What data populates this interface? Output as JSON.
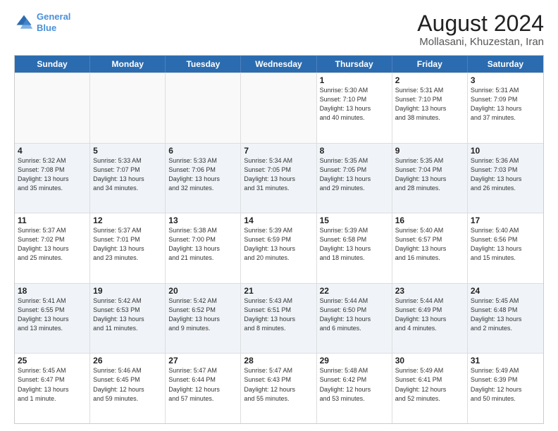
{
  "header": {
    "logo_line1": "General",
    "logo_line2": "Blue",
    "main_title": "August 2024",
    "sub_title": "Mollasani, Khuzestan, Iran"
  },
  "days_of_week": [
    "Sunday",
    "Monday",
    "Tuesday",
    "Wednesday",
    "Thursday",
    "Friday",
    "Saturday"
  ],
  "rows": [
    [
      {
        "day": "",
        "info": "",
        "empty": true
      },
      {
        "day": "",
        "info": "",
        "empty": true
      },
      {
        "day": "",
        "info": "",
        "empty": true
      },
      {
        "day": "",
        "info": "",
        "empty": true
      },
      {
        "day": "1",
        "info": "Sunrise: 5:30 AM\nSunset: 7:10 PM\nDaylight: 13 hours\nand 40 minutes.",
        "empty": false
      },
      {
        "day": "2",
        "info": "Sunrise: 5:31 AM\nSunset: 7:10 PM\nDaylight: 13 hours\nand 38 minutes.",
        "empty": false
      },
      {
        "day": "3",
        "info": "Sunrise: 5:31 AM\nSunset: 7:09 PM\nDaylight: 13 hours\nand 37 minutes.",
        "empty": false
      }
    ],
    [
      {
        "day": "4",
        "info": "Sunrise: 5:32 AM\nSunset: 7:08 PM\nDaylight: 13 hours\nand 35 minutes.",
        "empty": false
      },
      {
        "day": "5",
        "info": "Sunrise: 5:33 AM\nSunset: 7:07 PM\nDaylight: 13 hours\nand 34 minutes.",
        "empty": false
      },
      {
        "day": "6",
        "info": "Sunrise: 5:33 AM\nSunset: 7:06 PM\nDaylight: 13 hours\nand 32 minutes.",
        "empty": false
      },
      {
        "day": "7",
        "info": "Sunrise: 5:34 AM\nSunset: 7:05 PM\nDaylight: 13 hours\nand 31 minutes.",
        "empty": false
      },
      {
        "day": "8",
        "info": "Sunrise: 5:35 AM\nSunset: 7:05 PM\nDaylight: 13 hours\nand 29 minutes.",
        "empty": false
      },
      {
        "day": "9",
        "info": "Sunrise: 5:35 AM\nSunset: 7:04 PM\nDaylight: 13 hours\nand 28 minutes.",
        "empty": false
      },
      {
        "day": "10",
        "info": "Sunrise: 5:36 AM\nSunset: 7:03 PM\nDaylight: 13 hours\nand 26 minutes.",
        "empty": false
      }
    ],
    [
      {
        "day": "11",
        "info": "Sunrise: 5:37 AM\nSunset: 7:02 PM\nDaylight: 13 hours\nand 25 minutes.",
        "empty": false
      },
      {
        "day": "12",
        "info": "Sunrise: 5:37 AM\nSunset: 7:01 PM\nDaylight: 13 hours\nand 23 minutes.",
        "empty": false
      },
      {
        "day": "13",
        "info": "Sunrise: 5:38 AM\nSunset: 7:00 PM\nDaylight: 13 hours\nand 21 minutes.",
        "empty": false
      },
      {
        "day": "14",
        "info": "Sunrise: 5:39 AM\nSunset: 6:59 PM\nDaylight: 13 hours\nand 20 minutes.",
        "empty": false
      },
      {
        "day": "15",
        "info": "Sunrise: 5:39 AM\nSunset: 6:58 PM\nDaylight: 13 hours\nand 18 minutes.",
        "empty": false
      },
      {
        "day": "16",
        "info": "Sunrise: 5:40 AM\nSunset: 6:57 PM\nDaylight: 13 hours\nand 16 minutes.",
        "empty": false
      },
      {
        "day": "17",
        "info": "Sunrise: 5:40 AM\nSunset: 6:56 PM\nDaylight: 13 hours\nand 15 minutes.",
        "empty": false
      }
    ],
    [
      {
        "day": "18",
        "info": "Sunrise: 5:41 AM\nSunset: 6:55 PM\nDaylight: 13 hours\nand 13 minutes.",
        "empty": false
      },
      {
        "day": "19",
        "info": "Sunrise: 5:42 AM\nSunset: 6:53 PM\nDaylight: 13 hours\nand 11 minutes.",
        "empty": false
      },
      {
        "day": "20",
        "info": "Sunrise: 5:42 AM\nSunset: 6:52 PM\nDaylight: 13 hours\nand 9 minutes.",
        "empty": false
      },
      {
        "day": "21",
        "info": "Sunrise: 5:43 AM\nSunset: 6:51 PM\nDaylight: 13 hours\nand 8 minutes.",
        "empty": false
      },
      {
        "day": "22",
        "info": "Sunrise: 5:44 AM\nSunset: 6:50 PM\nDaylight: 13 hours\nand 6 minutes.",
        "empty": false
      },
      {
        "day": "23",
        "info": "Sunrise: 5:44 AM\nSunset: 6:49 PM\nDaylight: 13 hours\nand 4 minutes.",
        "empty": false
      },
      {
        "day": "24",
        "info": "Sunrise: 5:45 AM\nSunset: 6:48 PM\nDaylight: 13 hours\nand 2 minutes.",
        "empty": false
      }
    ],
    [
      {
        "day": "25",
        "info": "Sunrise: 5:45 AM\nSunset: 6:47 PM\nDaylight: 13 hours\nand 1 minute.",
        "empty": false
      },
      {
        "day": "26",
        "info": "Sunrise: 5:46 AM\nSunset: 6:45 PM\nDaylight: 12 hours\nand 59 minutes.",
        "empty": false
      },
      {
        "day": "27",
        "info": "Sunrise: 5:47 AM\nSunset: 6:44 PM\nDaylight: 12 hours\nand 57 minutes.",
        "empty": false
      },
      {
        "day": "28",
        "info": "Sunrise: 5:47 AM\nSunset: 6:43 PM\nDaylight: 12 hours\nand 55 minutes.",
        "empty": false
      },
      {
        "day": "29",
        "info": "Sunrise: 5:48 AM\nSunset: 6:42 PM\nDaylight: 12 hours\nand 53 minutes.",
        "empty": false
      },
      {
        "day": "30",
        "info": "Sunrise: 5:49 AM\nSunset: 6:41 PM\nDaylight: 12 hours\nand 52 minutes.",
        "empty": false
      },
      {
        "day": "31",
        "info": "Sunrise: 5:49 AM\nSunset: 6:39 PM\nDaylight: 12 hours\nand 50 minutes.",
        "empty": false
      }
    ]
  ]
}
